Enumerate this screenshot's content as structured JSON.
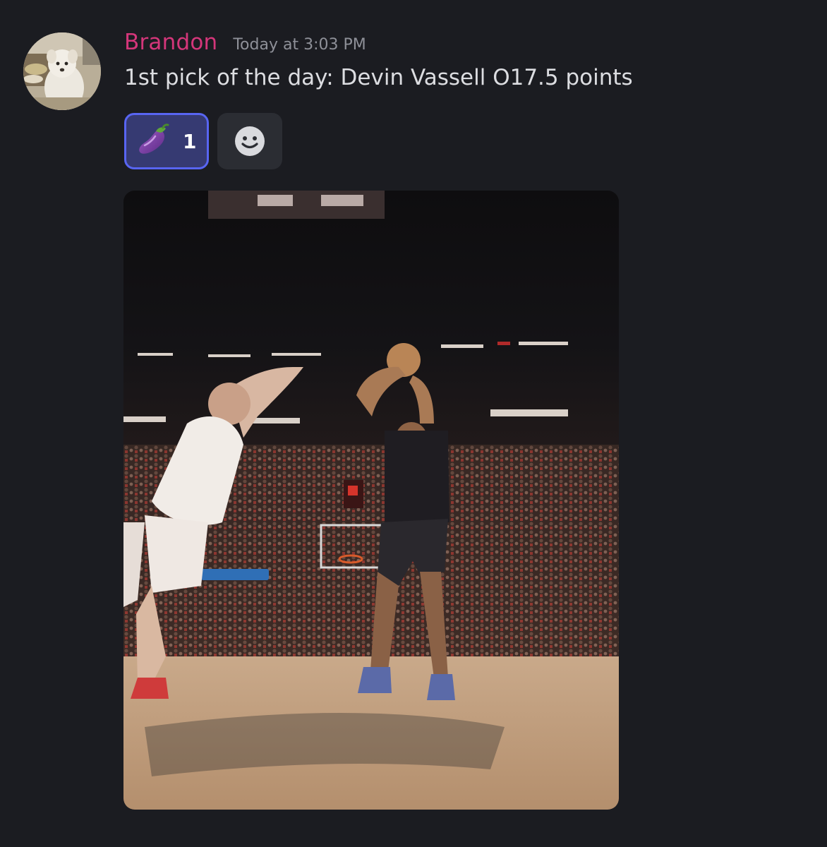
{
  "message": {
    "author": "Brandon",
    "timestamp": "Today at 3:03 PM",
    "content": "1st pick of the day: Devin Vassell O17.5 points",
    "avatar_icon": "dog-avatar",
    "author_color": "#d4367a"
  },
  "reactions": [
    {
      "emoji": "eggplant",
      "count": "1",
      "active": true
    },
    {
      "emoji": "add-reaction-smiley-icon",
      "count": null,
      "active": false
    }
  ],
  "attachment": {
    "type": "image",
    "subject": "basketball-jump-shot-photo"
  },
  "colors": {
    "background": "#1b1c21",
    "accent": "#5865f2",
    "reaction_active_bg": "#363a72"
  }
}
